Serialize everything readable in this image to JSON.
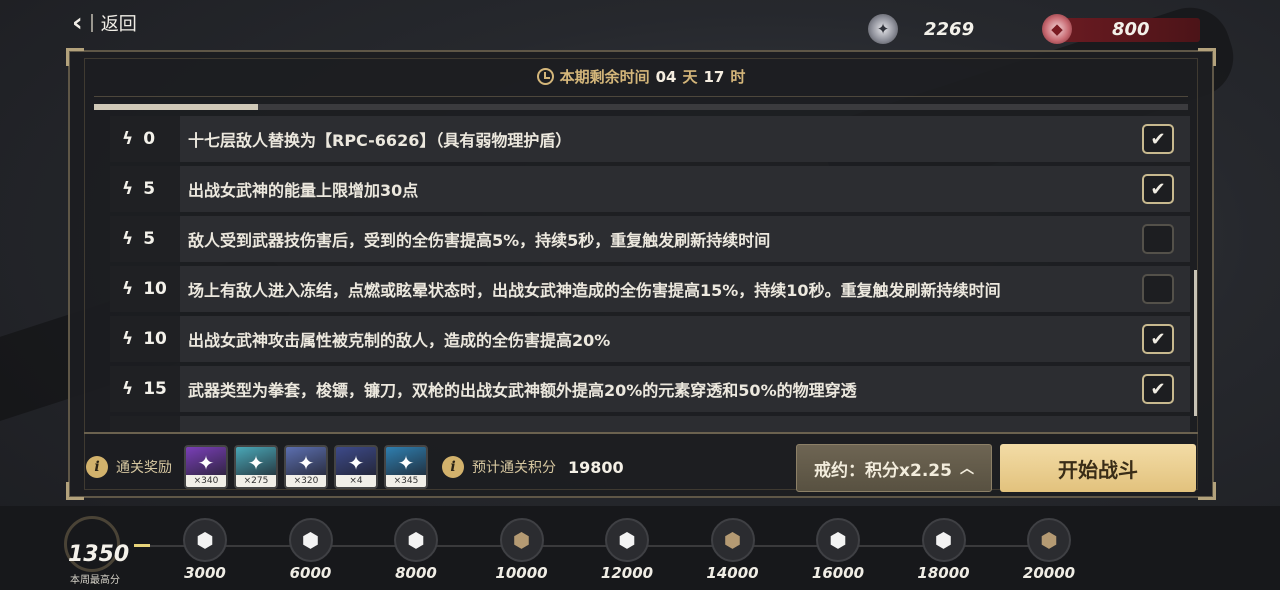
{
  "topbar": {
    "back_label": "返回",
    "currency_gold": "2269",
    "currency_red": "800"
  },
  "panel": {
    "timer_label": "本期剩余时间",
    "days": "04",
    "days_unit": "天",
    "hours": "17",
    "hours_unit": "时",
    "progress_fraction": 0.15
  },
  "conditions": [
    {
      "cost": "0",
      "text": "十七层敌人替换为【RPC-6626】（具有弱物理护盾）",
      "checked": true
    },
    {
      "cost": "5",
      "text": "出战女武神的能量上限增加30点",
      "checked": true
    },
    {
      "cost": "5",
      "text": "敌人受到武器技伤害后，受到的全伤害提高5%，持续5秒，重复触发刷新持续时间",
      "checked": false
    },
    {
      "cost": "10",
      "text": "场上有敌人进入冻结，点燃或眩晕状态时，出战女武神造成的全伤害提高15%，持续10秒。重复触发刷新持续时间",
      "checked": false
    },
    {
      "cost": "10",
      "text": "出战女武神攻击属性被克制的敌人，造成的全伤害提高20%",
      "checked": true
    },
    {
      "cost": "15",
      "text": "武器类型为拳套，梭镖，镰刀，双枪的出战女武神额外提高20%的元素穿透和50%的物理穿透",
      "checked": true
    }
  ],
  "rewards": {
    "label": "通关奖励",
    "items": [
      {
        "icon": "valkyrie-crystal-icon",
        "count": "×340",
        "color": "#7a3fb8"
      },
      {
        "icon": "green-disc-icon",
        "count": "×275",
        "color": "#4aa8b8"
      },
      {
        "icon": "purple-armor-icon",
        "count": "×320",
        "color": "#5c6fb0"
      },
      {
        "icon": "pink-gem-icon",
        "count": "×4",
        "color": "#3d4a8a"
      },
      {
        "icon": "blue-crystal-icon",
        "count": "×345",
        "color": "#2f7fb0"
      }
    ],
    "estimate_label": "预计通关积分",
    "estimate_value": "19800"
  },
  "buttons": {
    "contract_label": "戒约：积分x2.25",
    "start_label": "开始战斗"
  },
  "milestones": {
    "best_score": "1350",
    "best_label": "本周最高分",
    "items": [
      {
        "value": "3000",
        "tier": "white"
      },
      {
        "value": "6000",
        "tier": "white"
      },
      {
        "value": "8000",
        "tier": "white"
      },
      {
        "value": "10000",
        "tier": "bronze"
      },
      {
        "value": "12000",
        "tier": "white"
      },
      {
        "value": "14000",
        "tier": "bronze"
      },
      {
        "value": "16000",
        "tier": "white"
      },
      {
        "value": "18000",
        "tier": "white"
      },
      {
        "value": "20000",
        "tier": "bronze"
      }
    ]
  }
}
